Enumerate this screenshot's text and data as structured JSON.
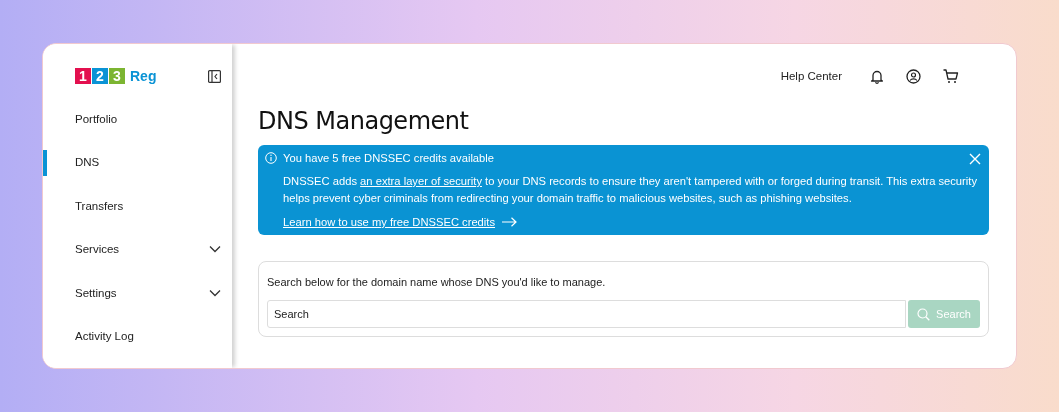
{
  "logo": {
    "digits": [
      {
        "text": "1",
        "color": "#e3104f"
      },
      {
        "text": "2",
        "color": "#0a93d5"
      },
      {
        "text": "3",
        "color": "#7cb531"
      }
    ],
    "name": "Reg"
  },
  "sidebar": {
    "items": [
      {
        "label": "Portfolio",
        "kind": "link",
        "selected": false
      },
      {
        "label": "DNS",
        "kind": "link",
        "selected": true
      },
      {
        "label": "Transfers",
        "kind": "link",
        "selected": false
      },
      {
        "label": "Services",
        "kind": "menu",
        "selected": false
      },
      {
        "label": "Settings",
        "kind": "menu",
        "selected": false
      },
      {
        "label": "Activity Log",
        "kind": "link",
        "selected": false
      }
    ]
  },
  "header": {
    "help_link": "Help Center"
  },
  "page_title": "DNS Management",
  "banner": {
    "title": "You have 5 free DNSSEC credits available",
    "description": {
      "before": "DNSSEC adds ",
      "link": "an extra layer of security",
      "after": " to your DNS records to ensure they aren't tampered with or forged during transit. This extra security helps prevent cyber criminals from redirecting your domain traffic to malicious websites, such as phishing websites."
    },
    "cta": "Learn how to use my free DNSSEC credits"
  },
  "search": {
    "prompt": "Search below for the domain name whose DNS you'd like to manage.",
    "placeholder": "Search",
    "button": "Search",
    "disabled": true
  }
}
